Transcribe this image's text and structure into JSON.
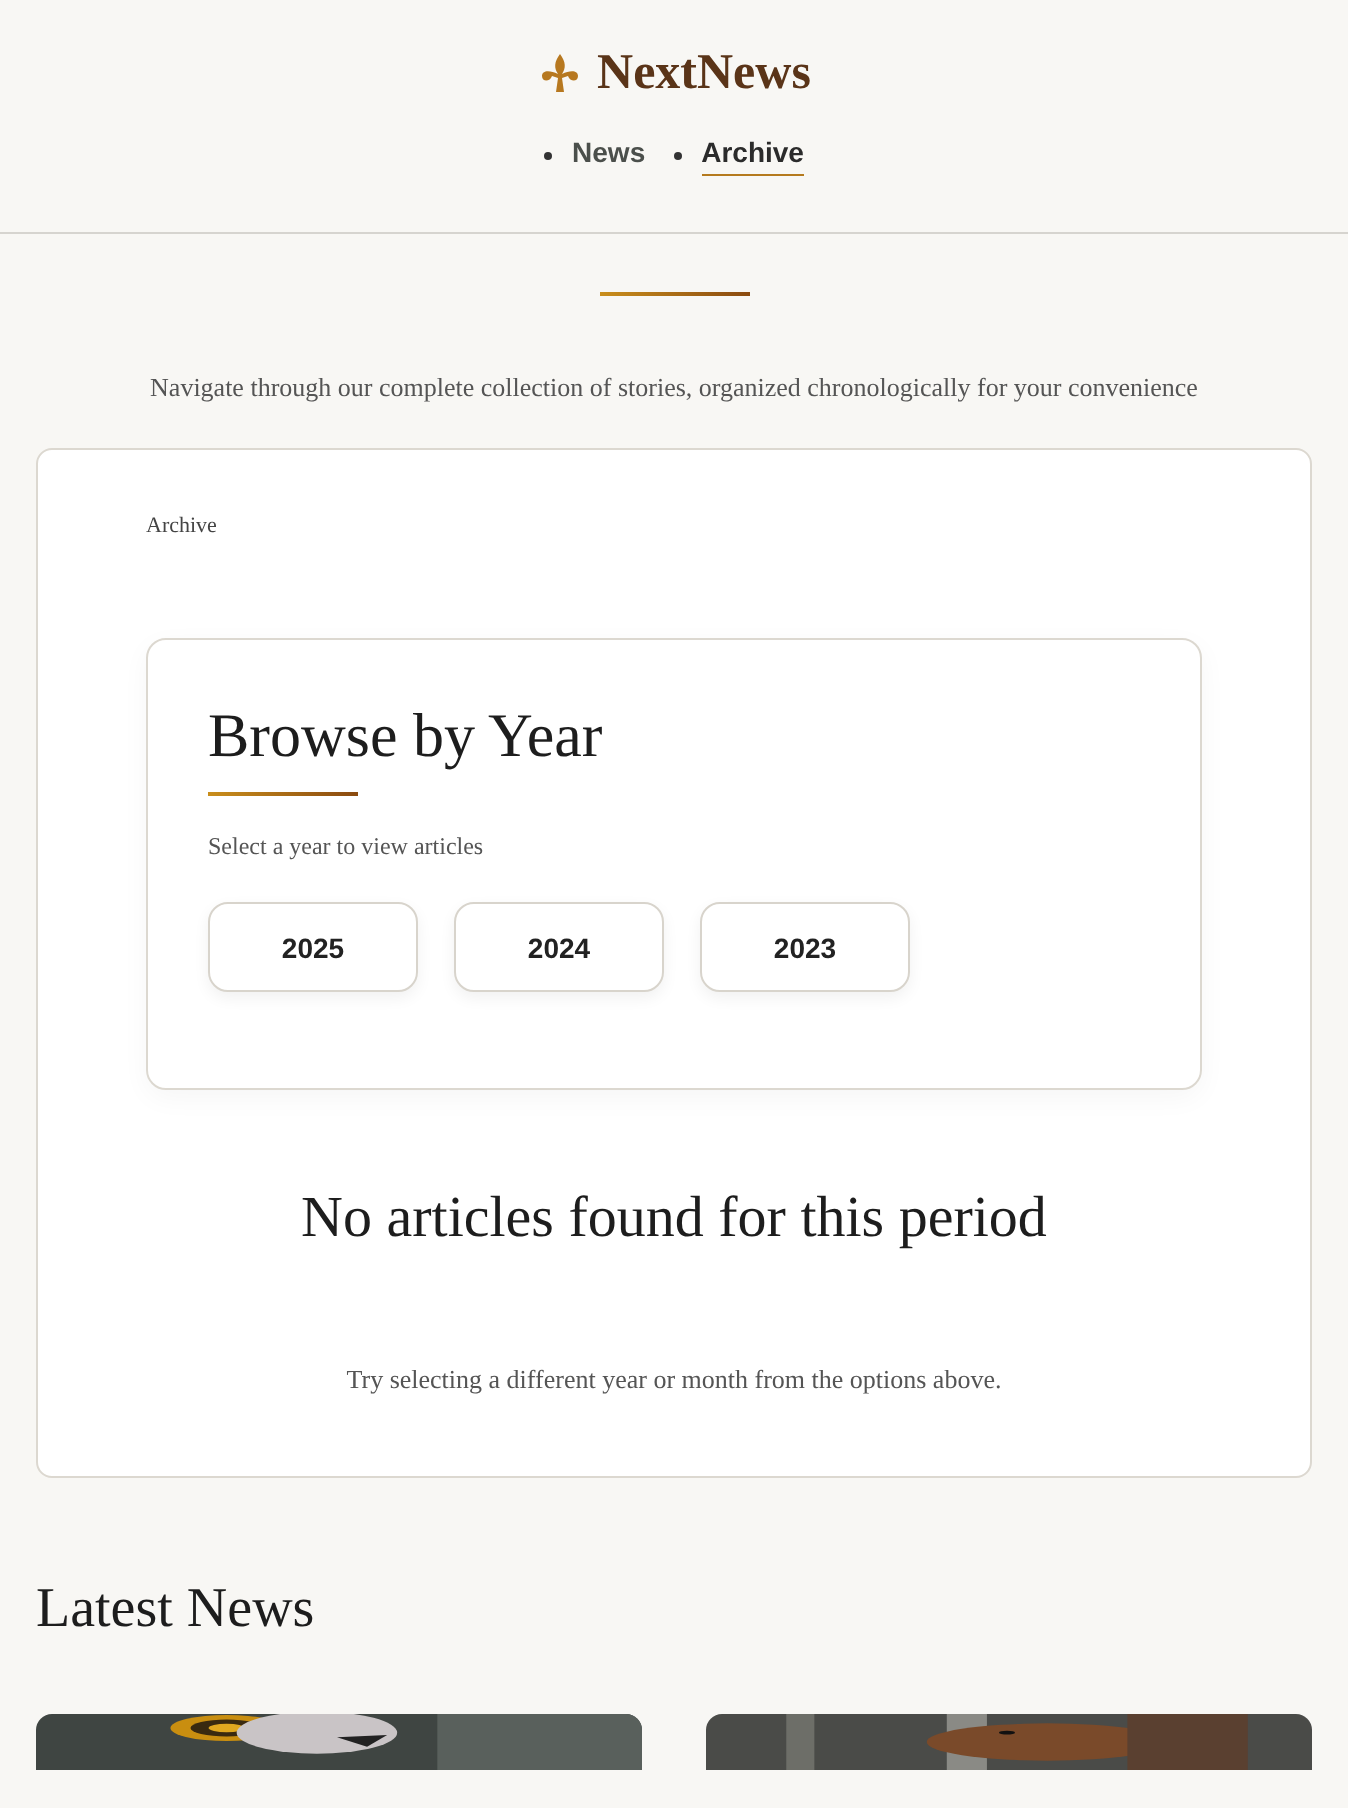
{
  "header": {
    "brand": "NextNews",
    "nav": [
      {
        "label": "News",
        "selected": false
      },
      {
        "label": "Archive",
        "selected": true
      }
    ]
  },
  "hero": {
    "subtitle": "Navigate through our complete collection of stories, organized chronologically for your convenience"
  },
  "archive_panel": {
    "breadcrumb": "Archive",
    "year_picker": {
      "title": "Browse by Year",
      "subtitle": "Select a year to view articles",
      "years": [
        "2025",
        "2024",
        "2023"
      ]
    },
    "empty_state": {
      "title": "No articles found for this period",
      "hint": "Try selecting a different year or month from the options above."
    }
  },
  "latest_news": {
    "title": "Latest News"
  }
}
